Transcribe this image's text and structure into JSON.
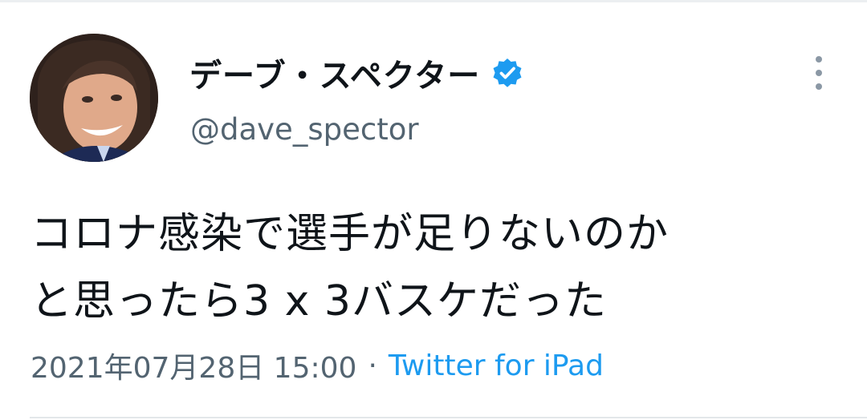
{
  "tweet": {
    "display_name": "デーブ・スペクター",
    "handle": "@dave_spector",
    "verified_icon": "verified-badge-icon",
    "more_icon": "more-vertical-icon",
    "text_line1": "コロナ感染で選手が足りないのか",
    "text_line2": "と思ったら3 x 3バスケだった",
    "timestamp": "2021年07月28日 15:00",
    "separator": "·",
    "source": "Twitter for iPad"
  },
  "colors": {
    "text_primary": "#0f1419",
    "text_secondary": "#536471",
    "link": "#1d9bf0",
    "verified": "#1d9bf0"
  }
}
